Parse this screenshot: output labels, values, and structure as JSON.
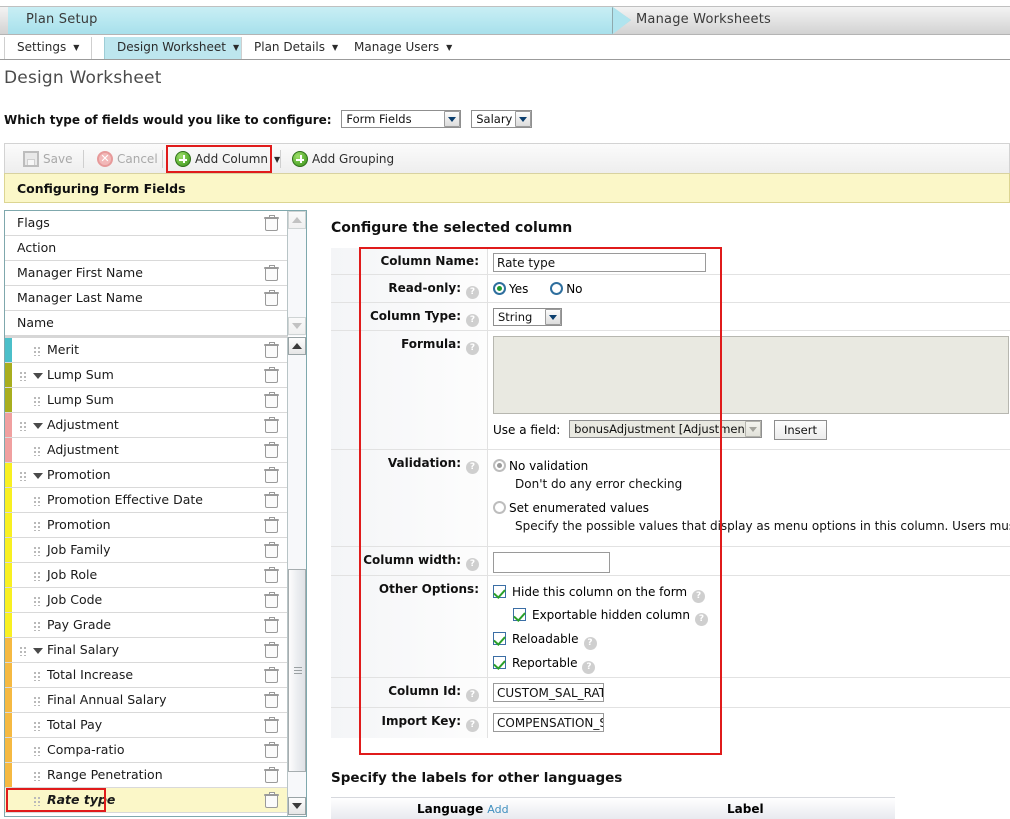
{
  "breadcrumb": {
    "step_active": "Plan Setup",
    "step_next": "Manage Worksheets"
  },
  "tabs": [
    {
      "label": "Settings",
      "selected": false
    },
    {
      "label": "Design Worksheet",
      "selected": true
    },
    {
      "label": "Plan Details",
      "selected": false
    },
    {
      "label": "Manage Users",
      "selected": false
    }
  ],
  "page": {
    "title": "Design Worksheet"
  },
  "field_type_row": {
    "label": "Which type of fields would you like to configure:",
    "select_primary": "Form Fields",
    "select_secondary": "Salary"
  },
  "toolbar": {
    "save_label": "Save",
    "cancel_label": "Cancel",
    "add_column_label": "Add Column",
    "add_grouping_label": "Add Grouping"
  },
  "banner": {
    "text": "Configuring Form Fields"
  },
  "column_list": {
    "fixed": [
      {
        "label": "Flags",
        "level": "lvl0",
        "bar": null,
        "trash": true
      },
      {
        "label": "Action",
        "level": "lvl0",
        "bar": null,
        "trash": false
      },
      {
        "label": "Manager First Name",
        "level": "lvl0",
        "bar": null,
        "trash": true
      },
      {
        "label": "Manager Last Name",
        "level": "lvl0",
        "bar": null,
        "trash": true
      },
      {
        "label": "Name",
        "level": "lvl0",
        "bar": null,
        "trash": false
      }
    ],
    "scrollable": [
      {
        "label": "Merit",
        "level": "lvlC",
        "bar": "#4bbfc9",
        "trash": true,
        "group": false
      },
      {
        "label": "Lump Sum",
        "level": "lvlG",
        "bar": "#a8ae1f",
        "trash": true,
        "group": true
      },
      {
        "label": "Lump Sum",
        "level": "lvlC",
        "bar": "#a8ae1f",
        "trash": true,
        "group": false
      },
      {
        "label": "Adjustment",
        "level": "lvlG",
        "bar": "#f0a0a0",
        "trash": true,
        "group": true
      },
      {
        "label": "Adjustment",
        "level": "lvlC",
        "bar": "#f0a0a0",
        "trash": true,
        "group": false
      },
      {
        "label": "Promotion",
        "level": "lvlG",
        "bar": "#f8f022",
        "trash": true,
        "group": true
      },
      {
        "label": "Promotion Effective Date",
        "level": "lvlC",
        "bar": "#f8f022",
        "trash": true,
        "group": false
      },
      {
        "label": "Promotion",
        "level": "lvlC",
        "bar": "#f8f022",
        "trash": true,
        "group": false
      },
      {
        "label": "Job Family",
        "level": "lvlC",
        "bar": "#f8f022",
        "trash": true,
        "group": false
      },
      {
        "label": "Job Role",
        "level": "lvlC",
        "bar": "#f8f022",
        "trash": true,
        "group": false
      },
      {
        "label": "Job Code",
        "level": "lvlC",
        "bar": "#f8f022",
        "trash": true,
        "group": false
      },
      {
        "label": "Pay Grade",
        "level": "lvlC",
        "bar": "#f8f022",
        "trash": true,
        "group": false
      },
      {
        "label": "Final Salary",
        "level": "lvlG",
        "bar": "#f5b942",
        "trash": true,
        "group": true
      },
      {
        "label": "Total Increase",
        "level": "lvlC",
        "bar": "#f5b942",
        "trash": true,
        "group": false
      },
      {
        "label": "Final Annual Salary",
        "level": "lvlC",
        "bar": "#f5b942",
        "trash": true,
        "group": false
      },
      {
        "label": "Total Pay",
        "level": "lvlC",
        "bar": "#f5b942",
        "trash": true,
        "group": false
      },
      {
        "label": "Compa-ratio",
        "level": "lvlC",
        "bar": "#f5b942",
        "trash": true,
        "group": false
      },
      {
        "label": "Range Penetration",
        "level": "lvlC",
        "bar": "#f5b942",
        "trash": true,
        "group": false
      },
      {
        "label": "Rate type",
        "level": "lvlC",
        "bar": null,
        "trash": true,
        "group": false,
        "selected": true
      }
    ]
  },
  "config": {
    "heading": "Configure the selected column",
    "column_name": {
      "label": "Column Name:",
      "value": "Rate type"
    },
    "read_only": {
      "label": "Read-only:",
      "yes": "Yes",
      "no": "No",
      "selected": "Yes"
    },
    "column_type": {
      "label": "Column Type:",
      "value": "String"
    },
    "formula": {
      "label": "Formula:",
      "value": "",
      "use_a_field_label": "Use a field:",
      "use_a_field_value": "bonusAdjustment [Adjustment]",
      "insert_label": "Insert"
    },
    "validation": {
      "label": "Validation:",
      "option_none": "No validation",
      "hint_none": "Don't do any error checking",
      "option_enum": "Set enumerated values",
      "hint_enum": "Specify the possible values that display as menu options in this column. Users must selec",
      "selected": "No validation"
    },
    "column_width": {
      "label": "Column width:",
      "value": ""
    },
    "other_options": {
      "label": "Other Options:",
      "items": [
        {
          "label": "Hide this column on the form",
          "checked": true,
          "indent": false
        },
        {
          "label": "Exportable hidden column",
          "checked": true,
          "indent": true
        },
        {
          "label": "Reloadable",
          "checked": true,
          "indent": false
        },
        {
          "label": "Reportable",
          "checked": true,
          "indent": false
        }
      ]
    },
    "column_id": {
      "label": "Column Id:",
      "value": "CUSTOM_SAL_RATE_TY"
    },
    "import_key": {
      "label": "Import Key:",
      "value": "COMPENSATION_SAL_R"
    }
  },
  "languages": {
    "heading": "Specify the labels for other languages",
    "col_language": "Language",
    "add_link": "Add",
    "col_label": "Label"
  },
  "colors": {
    "accent": "#bde6ee",
    "highlight_red": "#e01b1b",
    "banner_yellow": "#fbf7c8",
    "checkmark_green": "#2aa02a"
  }
}
